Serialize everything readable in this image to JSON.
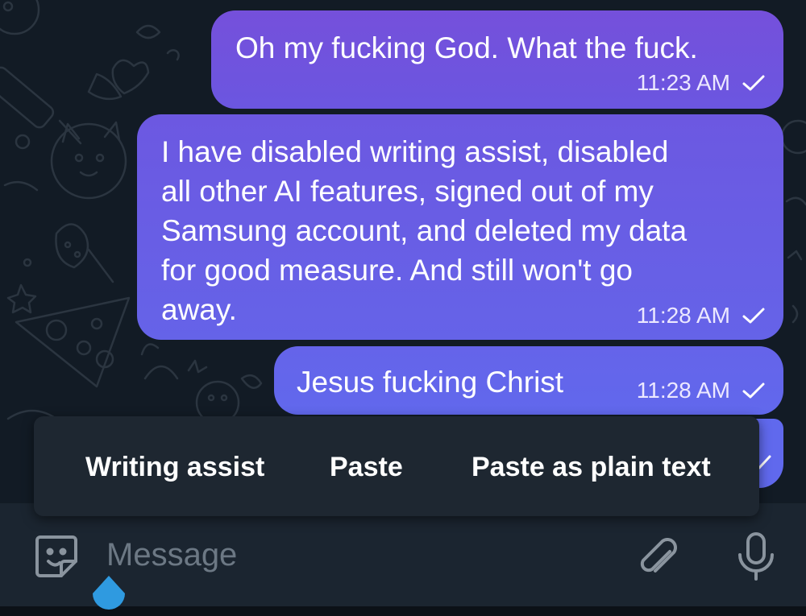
{
  "messages": [
    {
      "text_lines": [
        "Oh my fucking God.  What the fuck."
      ],
      "time": "11:23 AM",
      "status_icon": "check-icon"
    },
    {
      "text_lines": [
        "I have disabled writing assist, disabled",
        "all other AI features, signed out of my",
        "Samsung account, and deleted my data",
        "for good measure.  And still won't go",
        "away."
      ],
      "time": "11:28 AM",
      "status_icon": "check-icon"
    },
    {
      "text_lines": [
        "Jesus fucking Christ"
      ],
      "time": "11:28 AM",
      "status_icon": "check-icon"
    }
  ],
  "context_menu": {
    "items": [
      "Writing assist",
      "Paste",
      "Paste as plain text"
    ]
  },
  "composer": {
    "placeholder": "Message"
  },
  "icons": {
    "left": "sticker-icon",
    "attach": "paperclip-icon",
    "mic": "microphone-icon",
    "handle": "text-cursor-handle"
  },
  "colors": {
    "bubble_top": "#7550db",
    "bubble_bottom": "#6069ed",
    "background": "#121b25",
    "menu": "#1e2731",
    "composer": "#1b2530",
    "handle": "#2f9ae0"
  }
}
